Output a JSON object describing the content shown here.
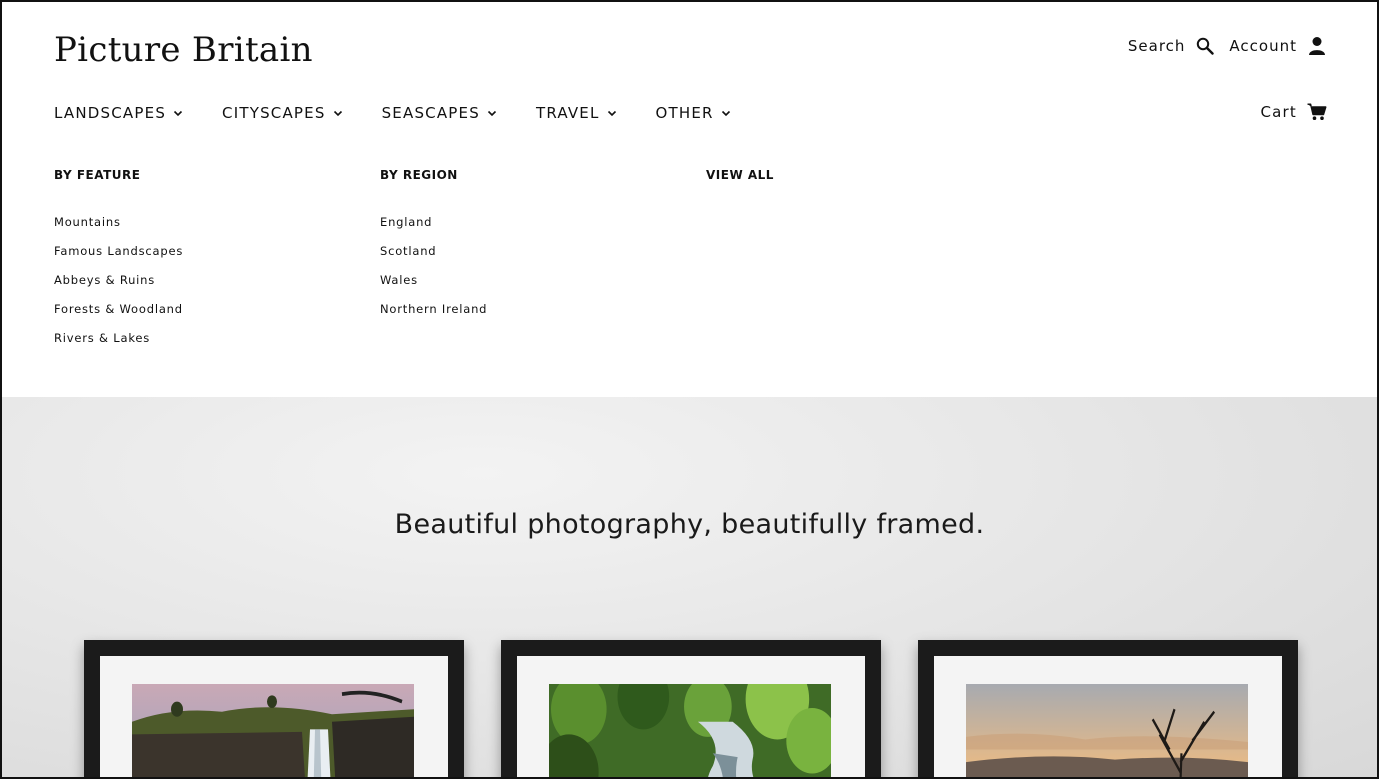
{
  "brand": {
    "logo_text": "Picture Britain"
  },
  "utility": {
    "search_label": "Search",
    "account_label": "Account"
  },
  "nav": {
    "items": [
      {
        "label": "LANDSCAPES"
      },
      {
        "label": "CITYSCAPES"
      },
      {
        "label": "SEASCAPES"
      },
      {
        "label": "TRAVEL"
      },
      {
        "label": "OTHER"
      }
    ],
    "cart_label": "Cart"
  },
  "mega_menu": {
    "by_feature": {
      "title": "BY FEATURE",
      "links": [
        "Mountains",
        "Famous Landscapes",
        "Abbeys & Ruins",
        "Forests & Woodland",
        "Rivers & Lakes"
      ]
    },
    "by_region": {
      "title": "BY REGION",
      "links": [
        "England",
        "Scotland",
        "Wales",
        "Northern Ireland"
      ]
    },
    "view_all": {
      "title": "VIEW ALL"
    }
  },
  "hero": {
    "tagline": "Beautiful photography, beautifully framed."
  },
  "icons": [
    "search-icon",
    "account-icon",
    "cart-icon",
    "chevron-down-icon"
  ],
  "colors": {
    "text": "#111111",
    "hero_bg": "#e4e4e4",
    "frame": "#1b1b1b",
    "mat": "#f4f4f4"
  }
}
